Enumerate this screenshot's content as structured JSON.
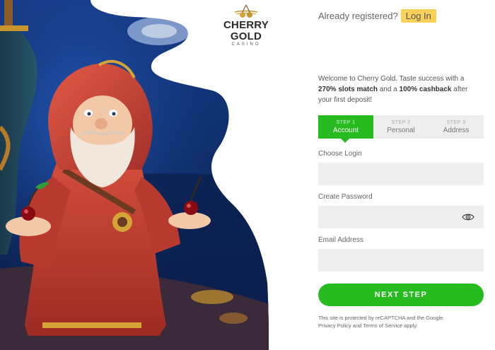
{
  "logo": {
    "name": "CHERRY GOLD",
    "sub": "CASINO"
  },
  "header": {
    "already_text": "Already registered?",
    "login_label": "Log In"
  },
  "welcome": {
    "part1": "Welcome to Cherry Gold. Taste success with a ",
    "bold1": "270% slots match",
    "part2": " and a ",
    "bold2": "100% cashback",
    "part3": " after your first deposit!"
  },
  "steps": [
    {
      "num": "STEP 1",
      "name": "Account",
      "active": true
    },
    {
      "num": "STEP 2",
      "name": "Personal",
      "active": false
    },
    {
      "num": "STEP 3",
      "name": "Address",
      "active": false
    }
  ],
  "form": {
    "login_label": "Choose Login",
    "login_value": "",
    "password_label": "Create Password",
    "password_value": "",
    "email_label": "Email Address",
    "email_value": "",
    "next_label": "NEXT STEP"
  },
  "recaptcha": {
    "line1": "This site is protected by reCAPTCHA and the Google",
    "privacy": "Privacy Policy",
    "and": " and ",
    "terms": "Terms of Service",
    "apply": " apply."
  },
  "icons": {
    "eye": "eye-icon",
    "cherries": "cherries-icon"
  },
  "colors": {
    "accent_green": "#27bb1f",
    "login_yellow": "#f7d15a",
    "field_bg": "#efefef"
  }
}
